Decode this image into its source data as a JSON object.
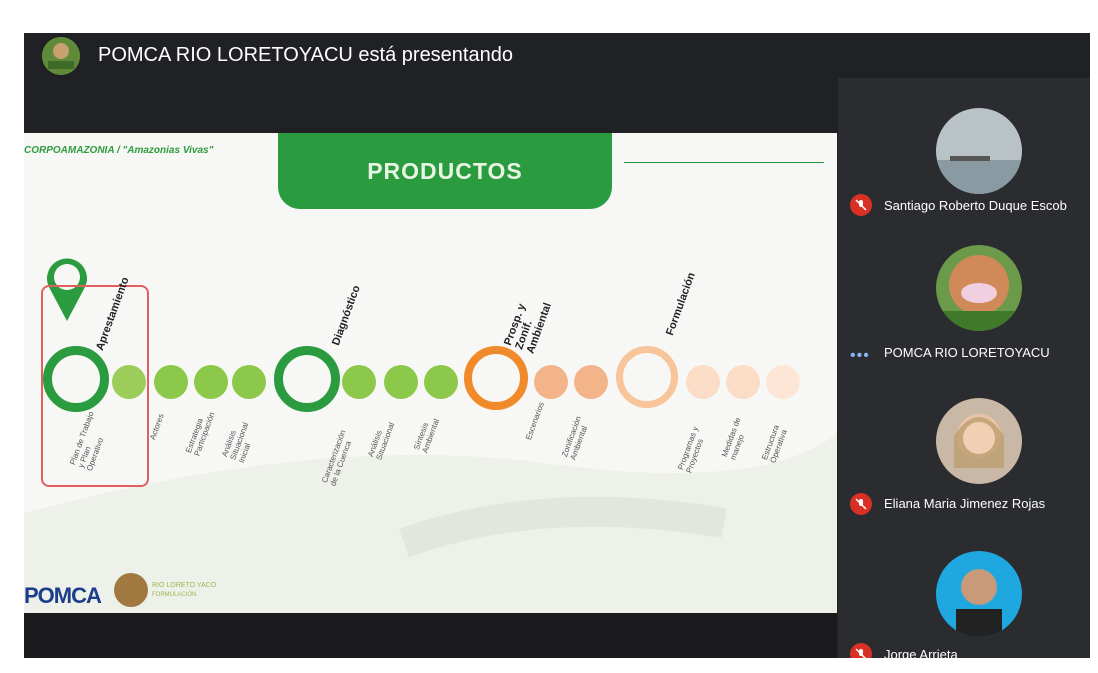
{
  "presenting_banner": {
    "title": "POMCA RIO LORETOYACU está presentando"
  },
  "slide": {
    "tag": "CORPOAMAZONIA / \"Amazonias Vivas\"",
    "title": "PRODUCTOS",
    "stages": [
      {
        "label": "Aprestamiento",
        "color": "#2a9c3f",
        "items": [
          "Plan de Trabajo\ny Plan\nOperativo",
          "Actores",
          "Estrategia\nParticipación",
          "Análisis\nSituacional\nInicial"
        ]
      },
      {
        "label": "Diagnóstico",
        "color": "#2a9c3f",
        "items": [
          "Caracterización\nde la Cuenca",
          "Análisis\nSituacional",
          "Síntesis\nAmbiental"
        ]
      },
      {
        "label": "Prosp. y\nZonif.\nAmbiental",
        "color": "#f08a2a",
        "items": [
          "Escenarios",
          "Zonificación\nAmbiental"
        ]
      },
      {
        "label": "Formulación",
        "color": "#f5b07a",
        "items": [
          "Programas y\nProyectos",
          "Medidas de\nmanejo",
          "Estructura\nOperativa"
        ]
      }
    ],
    "footer": {
      "logo_text": "POMCA",
      "sub_line1": "RIO LORETO YACO",
      "sub_line2": "FORMULACIÓN"
    }
  },
  "participants": [
    {
      "name": "Santiago Roberto Duque Escob",
      "muted": true,
      "avatar": "landscape-photo"
    },
    {
      "name": "POMCA RIO LORETOYACU",
      "muted": false,
      "speaking_indicator": "•••",
      "avatar": "dolphin-logo"
    },
    {
      "name": "Eliana Maria Jimenez Rojas",
      "muted": true,
      "avatar": "woman-photo"
    },
    {
      "name": "Jorge Arrieta",
      "muted": true,
      "avatar": "man-photo"
    }
  ],
  "colors": {
    "meeting_bg": "#202124",
    "sidebar_bg": "#2b2c30",
    "mic_off": "#d93025",
    "brand_green": "#2a9c3f",
    "prosp_orange": "#f08a2a"
  },
  "icons": [
    "mic-off-icon",
    "location-pin-icon",
    "more-dots-icon"
  ]
}
